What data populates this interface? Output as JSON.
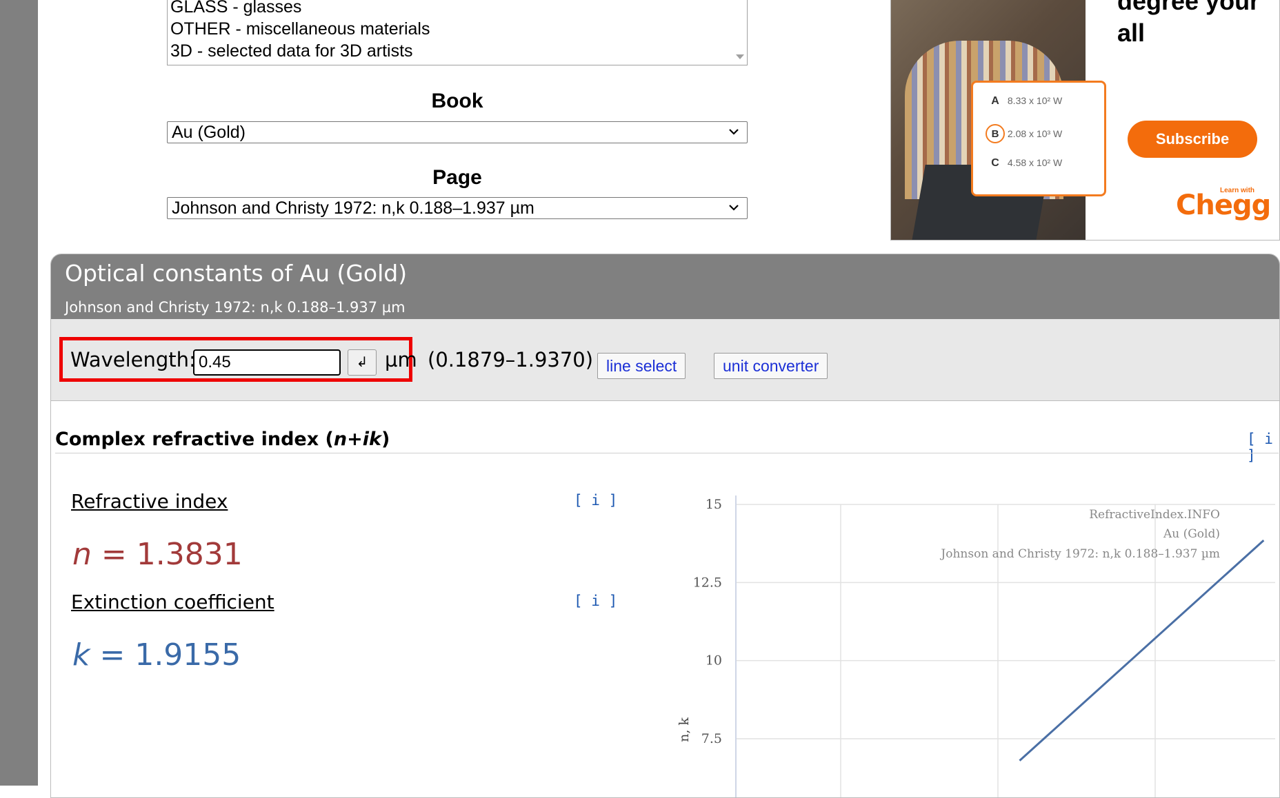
{
  "shelf_list": {
    "options": [
      "GLASS - glasses",
      "OTHER - miscellaneous materials",
      "3D - selected data for 3D artists"
    ]
  },
  "book": {
    "label": "Book",
    "selected": "Au (Gold)"
  },
  "page": {
    "label": "Page",
    "selected": "Johnson and Christy 1972: n,k 0.188–1.937 µm"
  },
  "ad": {
    "headline": "degree your\nall",
    "card_rows": [
      {
        "letter": "A",
        "value": "8.33 x 10² W"
      },
      {
        "letter": "B",
        "value": "2.08 x 10³ W"
      },
      {
        "letter": "C",
        "value": "4.58 x 10² W"
      }
    ],
    "subscribe": "Subscribe",
    "brand_small": "Learn with",
    "brand": "Chegg"
  },
  "panel": {
    "title": "Optical constants of Au (Gold)",
    "subtitle": "Johnson and Christy 1972: n,k 0.188–1.937 µm"
  },
  "controls": {
    "wavelength_label": "Wavelength:",
    "wavelength_value": "0.45",
    "enter_symbol": "↲",
    "unit": "µm",
    "range": "(0.1879–1.9370)",
    "line_select": "line select",
    "unit_converter": "unit converter"
  },
  "section": {
    "title_plain": "Complex refractive index (",
    "title_italic": "n+ik",
    "title_close": ")",
    "info": "[ i ]"
  },
  "refractive": {
    "label": "Refractive index",
    "info": "[ i ]",
    "symbol": "n",
    "eq": " = ",
    "value": "1.3831"
  },
  "extinction": {
    "label": "Extinction coefficient",
    "info": "[ i ]",
    "symbol": "k",
    "eq": " = ",
    "value": "1.9155"
  },
  "chart_data": {
    "type": "line",
    "ylabel": "n, k",
    "yticks": [
      "15",
      "12.5",
      "10",
      "7.5"
    ],
    "ylim": [
      7.5,
      15
    ],
    "grid": true,
    "watermark": [
      "RefractiveIndex.INFO",
      "Au (Gold)",
      "Johnson and Christy 1972: n,k 0.188–1.937 µm"
    ],
    "series": [
      {
        "color": "#4a6fa5",
        "points": [
          [
            0.62,
            6.8
          ],
          [
            1.05,
            13.85
          ]
        ]
      }
    ],
    "xlim": [
      0.12,
      1.08
    ]
  }
}
